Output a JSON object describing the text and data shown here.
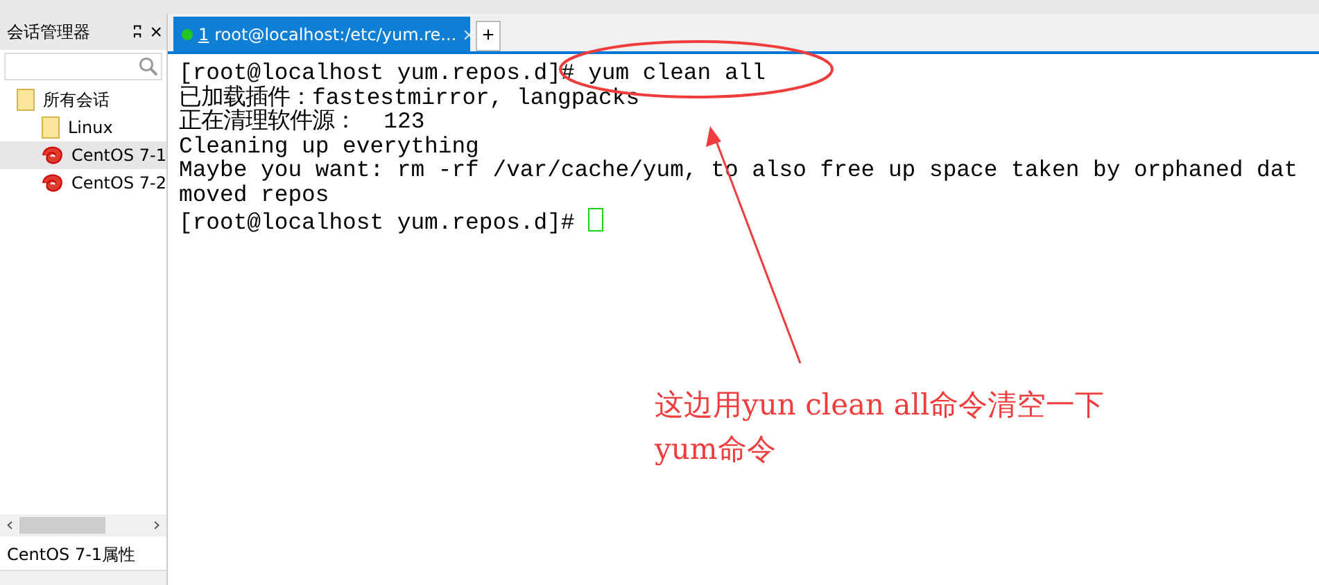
{
  "sidebar": {
    "title": "会话管理器",
    "pin_glyph": "ʭ",
    "close_glyph": "×",
    "tree": [
      {
        "label": "所有会话",
        "kind": "folder",
        "selected": false,
        "children": [
          {
            "label": "Linux",
            "kind": "folder",
            "selected": false
          },
          {
            "label": "CentOS 7-1",
            "kind": "session",
            "selected": true
          },
          {
            "label": "CentOS 7-2",
            "kind": "session",
            "selected": false
          }
        ]
      }
    ],
    "scroll_left": "‹",
    "scroll_right": "›",
    "properties_title": "CentOS 7-1属性"
  },
  "tabs": [
    {
      "number": "1",
      "label": "root@localhost:/etc/yum.re...",
      "selected": true,
      "connected": true,
      "close": "×"
    }
  ],
  "new_tab": "+",
  "terminal": {
    "lines": [
      "[root@localhost yum.repos.d]# yum clean all",
      "已加载插件：fastestmirror, langpacks",
      "正在清理软件源：  123",
      "Cleaning up everything",
      "Maybe you want: rm -rf /var/cache/yum, to also free up space taken by orphaned dat",
      "moved repos",
      "[root@localhost yum.repos.d]# "
    ],
    "cursor": true
  },
  "annotation": {
    "lines": [
      "这边用yun clean all命令清空一下",
      "yum命令"
    ]
  }
}
